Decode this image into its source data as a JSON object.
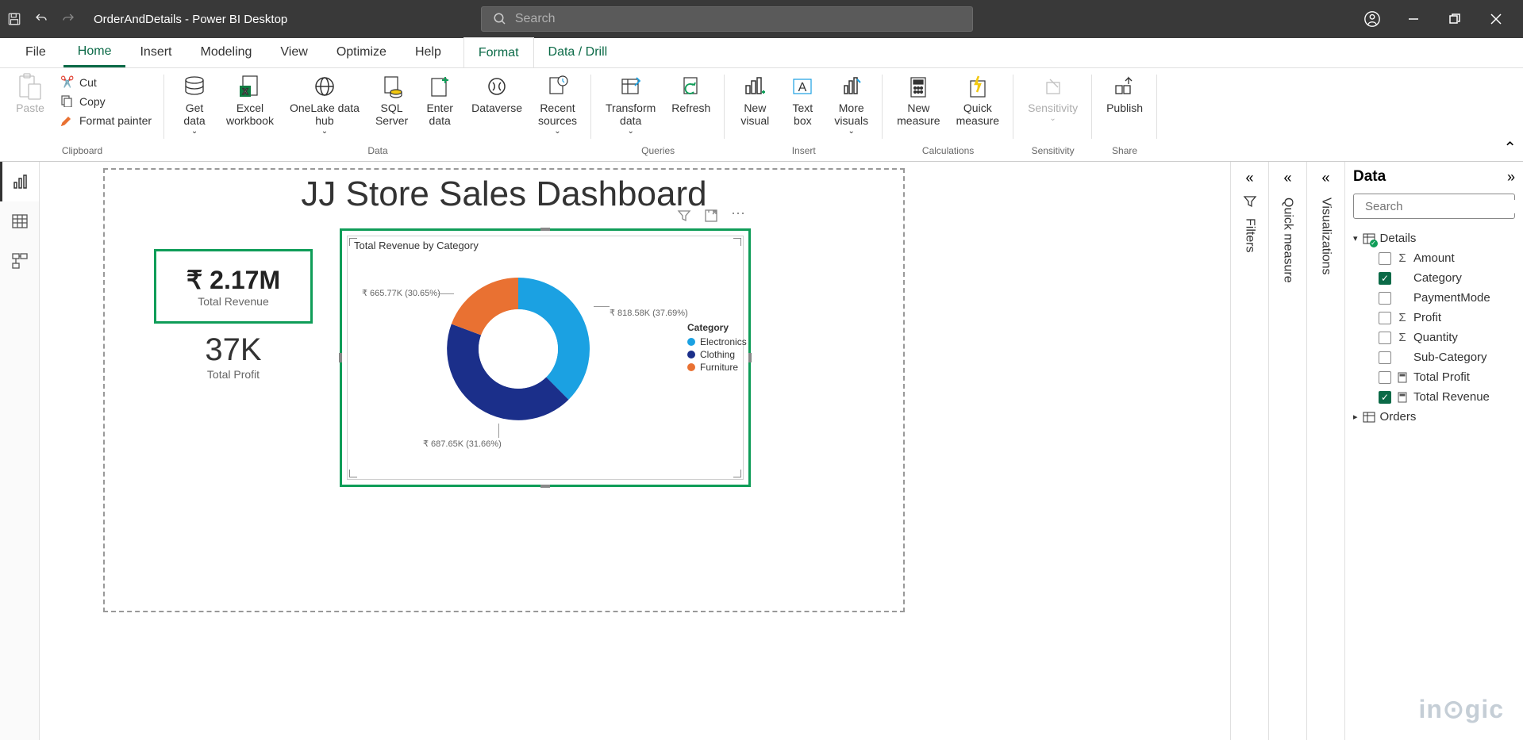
{
  "titlebar": {
    "document_title": "OrderAndDetails - Power BI Desktop",
    "search_placeholder": "Search"
  },
  "tabs": {
    "file": "File",
    "home": "Home",
    "insert": "Insert",
    "modeling": "Modeling",
    "view": "View",
    "optimize": "Optimize",
    "help": "Help",
    "format": "Format",
    "data_drill": "Data / Drill"
  },
  "ribbon": {
    "paste": "Paste",
    "cut": "Cut",
    "copy": "Copy",
    "format_painter": "Format painter",
    "clipboard_group": "Clipboard",
    "get_data": "Get\ndata",
    "excel": "Excel\nworkbook",
    "onelake": "OneLake data\nhub",
    "sql": "SQL\nServer",
    "enter": "Enter\ndata",
    "dataverse": "Dataverse",
    "recent": "Recent\nsources",
    "data_group": "Data",
    "transform": "Transform\ndata",
    "refresh": "Refresh",
    "queries_group": "Queries",
    "new_visual": "New\nvisual",
    "text_box": "Text\nbox",
    "more_visuals": "More\nvisuals",
    "insert_group": "Insert",
    "new_measure": "New\nmeasure",
    "quick_measure_btn": "Quick\nmeasure",
    "calculations_group": "Calculations",
    "sensitivity": "Sensitivity",
    "sensitivity_group": "Sensitivity",
    "publish": "Publish",
    "share_group": "Share"
  },
  "canvas": {
    "page_title": "JJ Store Sales Dashboard",
    "card1_value": "₹ 2.17M",
    "card1_label": "Total Revenue",
    "card2_value": "37K",
    "card2_label": "Total Profit",
    "chart_title": "Total Revenue by Category"
  },
  "chart_data": {
    "type": "pie",
    "title": "Total Revenue by Category",
    "legend_title": "Category",
    "series": [
      {
        "name": "Electronics",
        "value": 818580,
        "label": "₹ 818.58K (37.69%)",
        "color": "#1ba1e2"
      },
      {
        "name": "Clothing",
        "value": 687650,
        "label": "₹ 687.65K (31.66%)",
        "color": "#1b2f8a"
      },
      {
        "name": "Furniture",
        "value": 665770,
        "label": "₹ 665.77K (30.65%)",
        "color": "#e97132"
      }
    ]
  },
  "panes": {
    "filters": "Filters",
    "quick_measure": "Quick measure",
    "visualizations": "Visualizations",
    "data": "Data",
    "search_placeholder": "Search"
  },
  "fields": {
    "table_details": "Details",
    "amount": "Amount",
    "category": "Category",
    "paymentmode": "PaymentMode",
    "profit": "Profit",
    "quantity": "Quantity",
    "subcategory": "Sub-Category",
    "total_profit": "Total Profit",
    "total_revenue": "Total Revenue",
    "table_orders": "Orders"
  },
  "watermark": "inogic"
}
